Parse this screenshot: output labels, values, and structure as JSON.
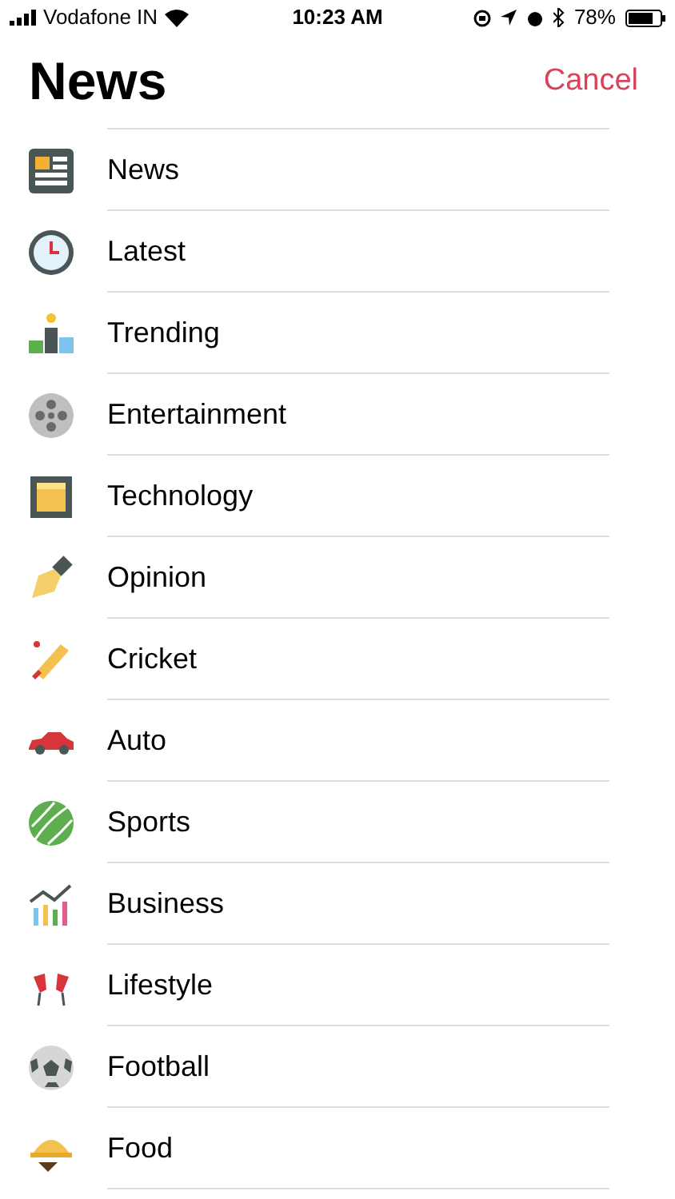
{
  "status_bar": {
    "carrier": "Vodafone IN",
    "time": "10:23 AM",
    "battery": "78%"
  },
  "header": {
    "title": "News",
    "cancel": "Cancel"
  },
  "items": [
    {
      "kind": "newspaper",
      "label": "News"
    },
    {
      "kind": "clock",
      "label": "Latest"
    },
    {
      "kind": "podium",
      "label": "Trending"
    },
    {
      "kind": "film",
      "label": "Entertainment"
    },
    {
      "kind": "chip",
      "label": "Technology"
    },
    {
      "kind": "pen",
      "label": "Opinion"
    },
    {
      "kind": "bat",
      "label": "Cricket"
    },
    {
      "kind": "car",
      "label": "Auto"
    },
    {
      "kind": "ball",
      "label": "Sports"
    },
    {
      "kind": "chart",
      "label": "Business"
    },
    {
      "kind": "glasses",
      "label": "Lifestyle"
    },
    {
      "kind": "football",
      "label": "Football"
    },
    {
      "kind": "cloche",
      "label": "Food"
    }
  ]
}
